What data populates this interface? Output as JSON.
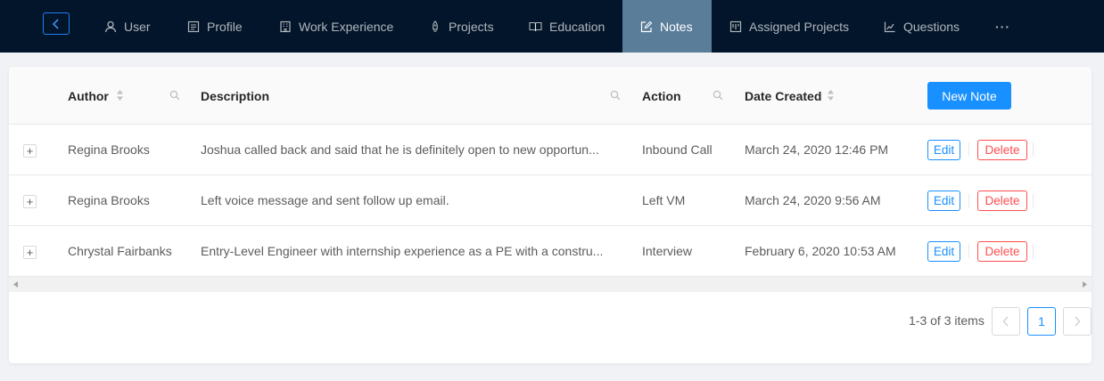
{
  "nav": {
    "items": [
      {
        "label": "User",
        "icon": "user-icon"
      },
      {
        "label": "Profile",
        "icon": "profile-icon"
      },
      {
        "label": "Work Experience",
        "icon": "building-icon"
      },
      {
        "label": "Projects",
        "icon": "rocket-icon"
      },
      {
        "label": "Education",
        "icon": "book-icon"
      },
      {
        "label": "Notes",
        "icon": "edit-icon",
        "active": true
      },
      {
        "label": "Assigned Projects",
        "icon": "board-icon"
      },
      {
        "label": "Questions",
        "icon": "chart-icon"
      }
    ],
    "more": "···"
  },
  "table": {
    "columns": {
      "author": "Author",
      "description": "Description",
      "action": "Action",
      "date_created": "Date Created"
    },
    "new_note_label": "New Note",
    "rows": [
      {
        "author": "Regina Brooks",
        "description": "Joshua called back and said that he is definitely open to new opportun...",
        "action": "Inbound Call",
        "date_created": "March 24, 2020 12:46 PM",
        "expand": "+",
        "edit_label": "Edit",
        "delete_label": "Delete"
      },
      {
        "author": "Regina Brooks",
        "description": "Left voice message and sent follow up email.",
        "action": "Left VM",
        "date_created": "March 24, 2020 9:56 AM",
        "expand": "+",
        "edit_label": "Edit",
        "delete_label": "Delete"
      },
      {
        "author": "Chrystal Fairbanks",
        "description": "Entry-Level Engineer with internship experience as a PE with a constru...",
        "action": "Interview",
        "date_created": "February 6, 2020 10:53 AM",
        "expand": "+",
        "edit_label": "Edit",
        "delete_label": "Delete"
      }
    ]
  },
  "pagination": {
    "summary": "1-3 of 3 items",
    "current_page": "1"
  },
  "colors": {
    "nav_bg": "#03152a",
    "nav_active": "#5a7d9a",
    "primary": "#1890ff",
    "danger": "#ff4d4f"
  }
}
